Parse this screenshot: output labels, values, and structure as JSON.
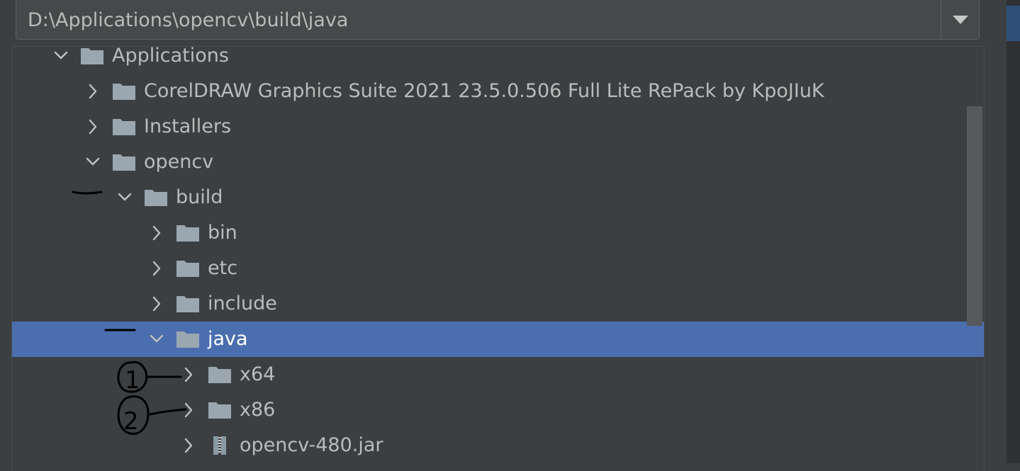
{
  "path_field": {
    "value": "D:\\Applications\\opencv\\build\\java",
    "dropdown_icon": "triangle-down-icon"
  },
  "tree": {
    "rows": [
      {
        "label": "Applications",
        "level": 0,
        "expanded": true,
        "icon": "folder-icon"
      },
      {
        "label": "CorelDRAW Graphics Suite 2021 23.5.0.506 Full  Lite RePack by KpoJIuK",
        "level": 1,
        "expanded": false,
        "icon": "folder-icon"
      },
      {
        "label": "Installers",
        "level": 1,
        "expanded": false,
        "icon": "folder-icon"
      },
      {
        "label": "opencv",
        "level": 1,
        "expanded": true,
        "icon": "folder-icon"
      },
      {
        "label": "build",
        "level": 2,
        "expanded": true,
        "icon": "folder-icon"
      },
      {
        "label": "bin",
        "level": 3,
        "expanded": false,
        "icon": "folder-icon"
      },
      {
        "label": "etc",
        "level": 3,
        "expanded": false,
        "icon": "folder-icon"
      },
      {
        "label": "include",
        "level": 3,
        "expanded": false,
        "icon": "folder-icon"
      },
      {
        "label": "java",
        "level": 3,
        "expanded": true,
        "icon": "folder-icon",
        "selected": true
      },
      {
        "label": "x64",
        "level": 4,
        "expanded": false,
        "icon": "folder-icon"
      },
      {
        "label": "x86",
        "level": 4,
        "expanded": false,
        "icon": "folder-icon"
      },
      {
        "label": "opencv-480.jar",
        "level": 4,
        "expanded": false,
        "icon": "jar-archive-icon"
      }
    ]
  },
  "annotations": {
    "marks": [
      "1",
      "2"
    ]
  },
  "colors": {
    "background": "#3c3f41",
    "selection": "#4b6eaf",
    "text": "#bbbbbb",
    "folder": "#9aa7b0"
  }
}
